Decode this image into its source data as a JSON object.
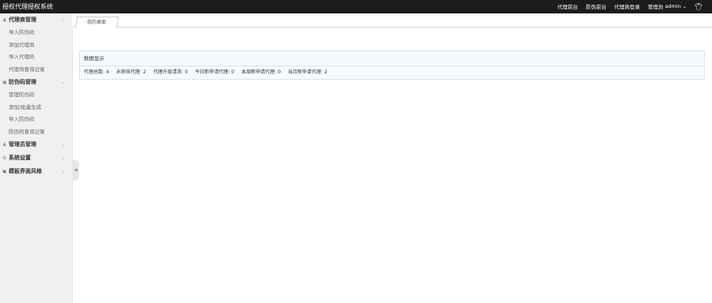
{
  "header": {
    "title": "授权代理授权系统",
    "nav": [
      "代理前台",
      "防伪前台",
      "代理商登录"
    ],
    "admin_label": "管理员",
    "admin_user": "admin",
    "skin_icon": "shirt-icon"
  },
  "sidebar": {
    "groups": [
      {
        "icon": "user-icon",
        "label": "代理商管理",
        "items": [
          "导入防伪码",
          "添加代理商",
          "导入代理码",
          "代理商查询记录"
        ]
      },
      {
        "icon": "card-icon",
        "label": "防伪码管理",
        "items": [
          "管理防伪码",
          "添加/批量生成",
          "导入防伪码",
          "防伪码查询记录"
        ]
      },
      {
        "icon": "person-icon",
        "label": "管理员管理",
        "items": []
      },
      {
        "icon": "gear-icon",
        "label": "系统设置",
        "items": []
      },
      {
        "icon": "circle-icon",
        "label": "模板界面风格",
        "items": []
      }
    ]
  },
  "tabs": [
    {
      "label": "我的桌面"
    }
  ],
  "panel": {
    "title": "数据显示",
    "stats": [
      {
        "label": "代理总数",
        "value": "4"
      },
      {
        "label": "未审核代理",
        "value": "2"
      },
      {
        "label": "代理升级请求",
        "value": "0"
      },
      {
        "label": "今日新申请代理",
        "value": "0"
      },
      {
        "label": "本周新申请代理",
        "value": "0"
      },
      {
        "label": "当月新申请代理",
        "value": "2"
      }
    ]
  }
}
